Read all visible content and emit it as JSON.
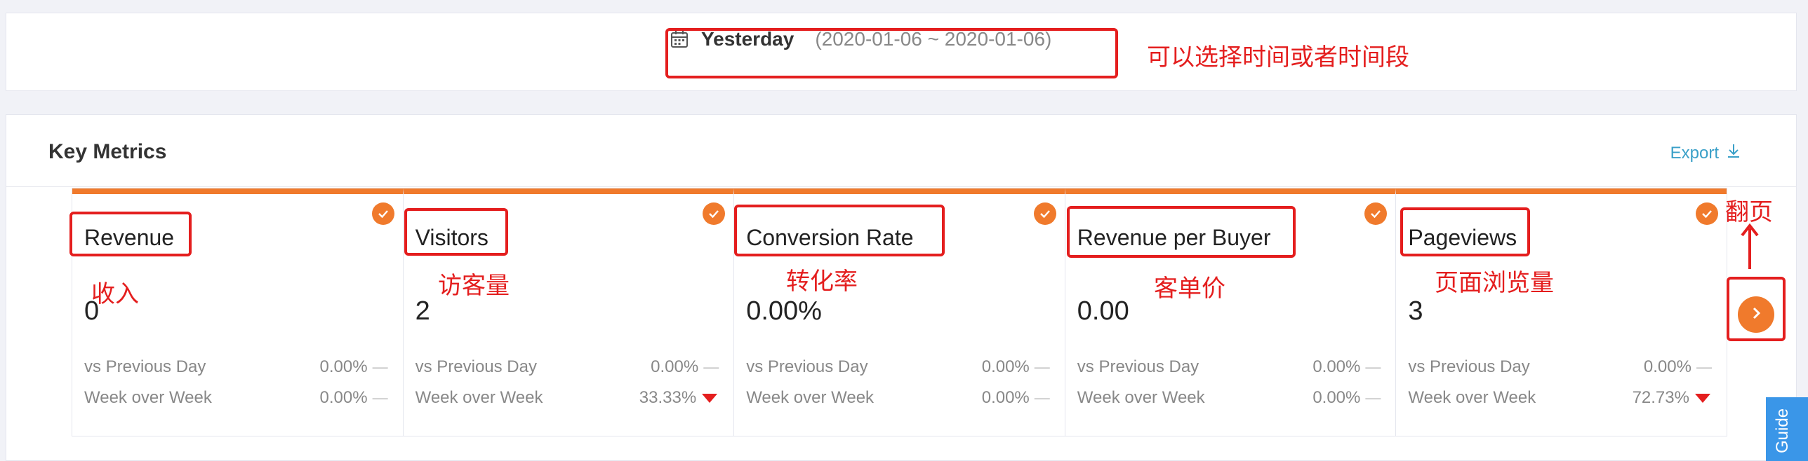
{
  "date_picker": {
    "label": "Yesterday",
    "range": "(2020-01-06 ~ 2020-01-06)"
  },
  "panel": {
    "title": "Key Metrics",
    "export_label": "Export"
  },
  "cards": [
    {
      "name": "Revenue",
      "value": "0",
      "rows": [
        {
          "label": "vs Previous Day",
          "value": "0.00%",
          "trend": "—"
        },
        {
          "label": "Week over Week",
          "value": "0.00%",
          "trend": "—"
        }
      ]
    },
    {
      "name": "Visitors",
      "value": "2",
      "rows": [
        {
          "label": "vs Previous Day",
          "value": "0.00%",
          "trend": "—"
        },
        {
          "label": "Week over Week",
          "value": "33.33%",
          "trend": "down"
        }
      ]
    },
    {
      "name": "Conversion Rate",
      "value": "0.00%",
      "rows": [
        {
          "label": "vs Previous Day",
          "value": "0.00%",
          "trend": "—"
        },
        {
          "label": "Week over Week",
          "value": "0.00%",
          "trend": "—"
        }
      ]
    },
    {
      "name": "Revenue per Buyer",
      "value": "0.00",
      "rows": [
        {
          "label": "vs Previous Day",
          "value": "0.00%",
          "trend": "—"
        },
        {
          "label": "Week over Week",
          "value": "0.00%",
          "trend": "—"
        }
      ]
    },
    {
      "name": "Pageviews",
      "value": "3",
      "rows": [
        {
          "label": "vs Previous Day",
          "value": "0.00%",
          "trend": "—"
        },
        {
          "label": "Week over Week",
          "value": "72.73%",
          "trend": "down"
        }
      ]
    }
  ],
  "annotations": {
    "date": "可以选择时间或者时间段",
    "revenue": "收入",
    "visitors": "访客量",
    "conversion": "转化率",
    "per_buyer": "客单价",
    "pageviews": "页面浏览量",
    "next_page": "翻页"
  },
  "guide": {
    "label": "Guide"
  },
  "colors": {
    "accent": "#f07a2c",
    "annotation": "#e41e1e",
    "link": "#3aa0c8",
    "guide": "#3a96e8"
  },
  "icons": {
    "date": "calendar-icon",
    "export": "download-icon",
    "check": "check-circle-icon",
    "next": "chevron-right-icon",
    "trend_down": "triangle-down-icon"
  }
}
